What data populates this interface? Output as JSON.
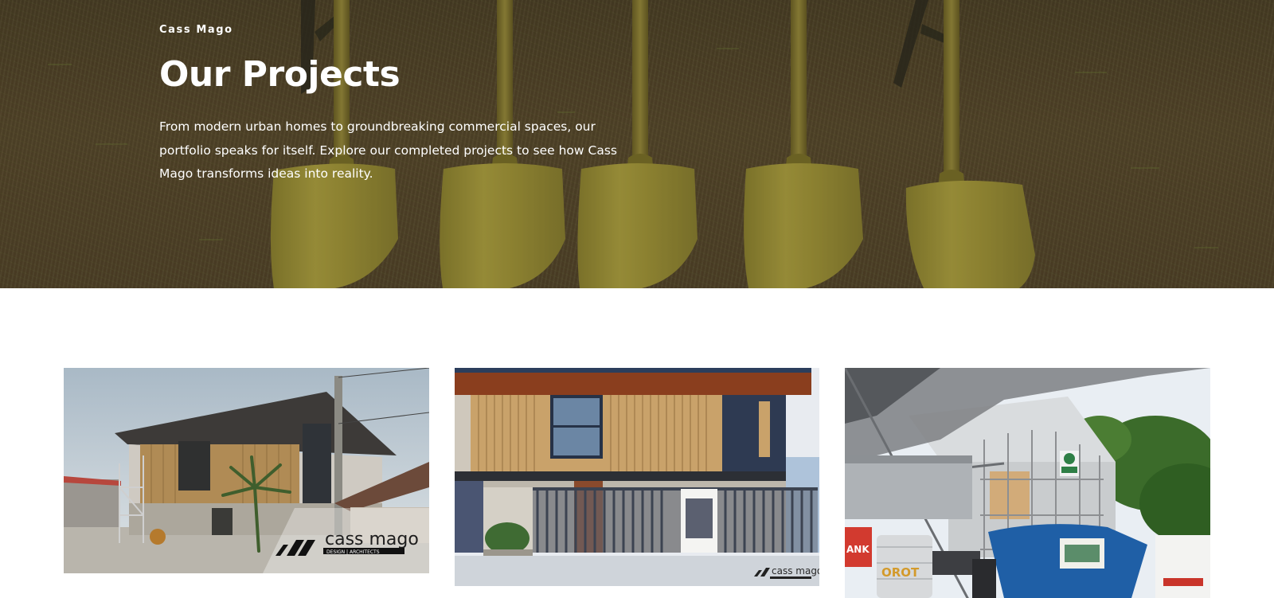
{
  "hero": {
    "eyebrow": "Cass Mago",
    "title": "Our Projects",
    "intro": "From modern urban homes to groundbreaking commercial spaces, our portfolio speaks for itself. Explore our completed projects to see how Cass Mago transforms ideas into reality.",
    "image_subject": "shovels-in-soil"
  },
  "projects": {
    "items": [
      {
        "name": "project-1",
        "subject": "two-storey house under construction with scaffolding",
        "watermark": "cass mago",
        "watermark_sub": "DESIGN | ARCHITECTS"
      },
      {
        "name": "project-2",
        "subject": "modern house with wood slat facade and steel gate",
        "watermark": "cass mago"
      },
      {
        "name": "project-3",
        "subject": "commercial building under construction with scaffolding",
        "signage": "ANK",
        "tank_text": "OROT"
      }
    ]
  },
  "colors": {
    "hero_text": "#ffffff",
    "shovel": "#a39736",
    "soil": "#55472b",
    "page_bg": "#ffffff"
  }
}
